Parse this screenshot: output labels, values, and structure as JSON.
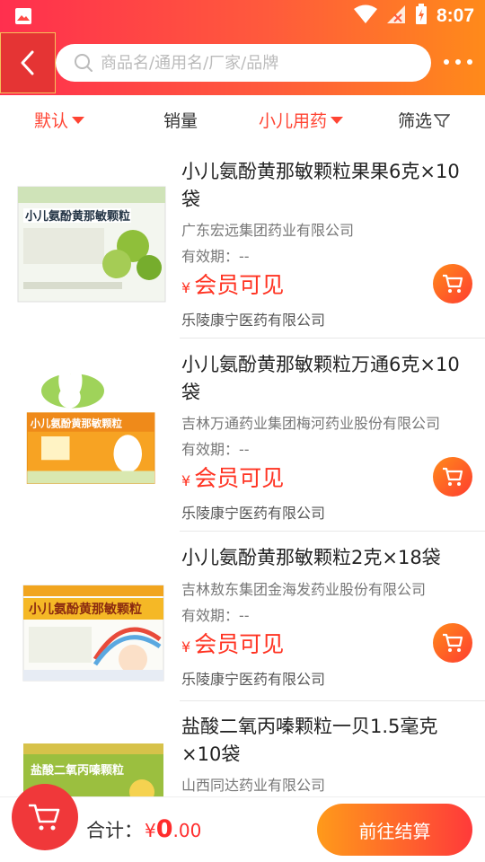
{
  "status_bar": {
    "time": "8:07",
    "icons": [
      "image-icon",
      "wifi-icon",
      "signal-icon",
      "battery-charging-icon"
    ]
  },
  "header": {
    "back_icon": "chevron-left-icon",
    "search_placeholder": "商品名/通用名/厂家/品牌",
    "more_icon": "more-dots-icon"
  },
  "filters": {
    "default_label": "默认",
    "sales_label": "销量",
    "category_label": "小儿用药",
    "screen_label": "筛选"
  },
  "products": [
    {
      "name": "小儿氨酚黄那敏颗粒果果6克×10袋",
      "manufacturer": "广东宏远集团药业有限公司",
      "expiry": "有效期：--",
      "currency": "¥",
      "price_text": "会员可见",
      "seller": "乐陵康宁医药有限公司",
      "box_label": "小儿氨酚黄那敏颗粒"
    },
    {
      "name": "小儿氨酚黄那敏颗粒万通6克×10袋",
      "manufacturer": "吉林万通药业集团梅河药业股份有限公司",
      "expiry": "有效期：--",
      "currency": "¥",
      "price_text": "会员可见",
      "seller": "乐陵康宁医药有限公司",
      "box_label": "小儿氨酚黄那敏颗粒"
    },
    {
      "name": "小儿氨酚黄那敏颗粒2克×18袋",
      "manufacturer": "吉林敖东集团金海发药业股份有限公司",
      "expiry": "有效期：--",
      "currency": "¥",
      "price_text": "会员可见",
      "seller": "乐陵康宁医药有限公司",
      "box_label": "小儿氨酚黄那敏颗粒"
    },
    {
      "name": "盐酸二氧丙嗪颗粒一贝1.5毫克×10袋",
      "manufacturer": "山西同达药业有限公司",
      "box_label": "盐酸二氧丙嗪颗粒"
    }
  ],
  "footer": {
    "total_label": "合计：",
    "currency": "¥",
    "total_int": "0",
    "total_dec": ".00",
    "checkout_label": "前往结算",
    "cart_icon": "shopping-cart-icon"
  },
  "colors": {
    "brand_red": "#ff3d30",
    "brand_orange": "#ff8a1a",
    "price_red": "#ff3322"
  }
}
